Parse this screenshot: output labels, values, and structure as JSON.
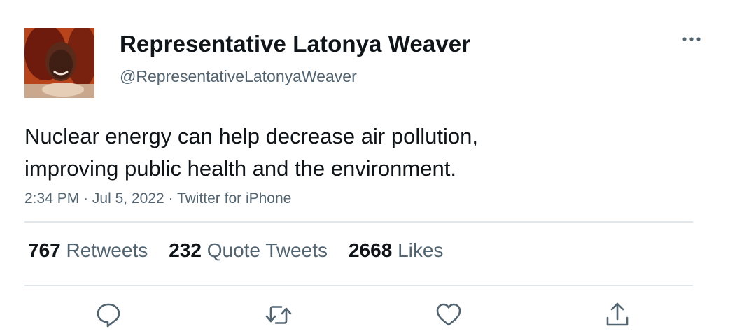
{
  "author": {
    "display_name": "Representative Latonya Weaver",
    "handle": "@RepresentativeLatonyaWeaver",
    "avatar_icon": "profile-photo"
  },
  "tweet": {
    "text_lines": [
      "Nuclear energy can help decrease air pollution,",
      "improving public health and the environment."
    ],
    "time": "2:34 PM",
    "date": "Jul 5, 2022",
    "source": "Twitter for iPhone",
    "separator": "·"
  },
  "stats": {
    "retweets": {
      "count": "767",
      "label": "Retweets"
    },
    "quote_tweets": {
      "count": "232",
      "label": "Quote Tweets"
    },
    "likes": {
      "count": "2668",
      "label": "Likes"
    }
  },
  "actions": [
    {
      "name": "reply",
      "icon": "reply-icon"
    },
    {
      "name": "retweet",
      "icon": "retweet-icon"
    },
    {
      "name": "like",
      "icon": "like-icon"
    },
    {
      "name": "share",
      "icon": "share-icon"
    }
  ],
  "colors": {
    "text_primary": "#0f1419",
    "text_secondary": "#536471",
    "divider": "#e1e6ea"
  }
}
